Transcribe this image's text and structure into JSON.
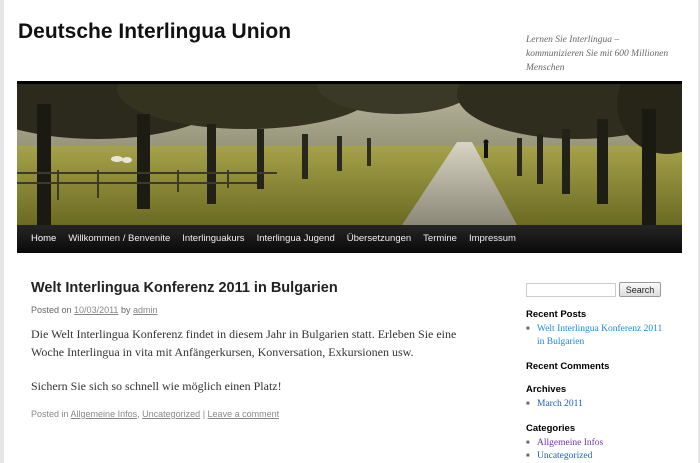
{
  "header": {
    "site_title": "Deutsche Interlingua Union",
    "site_description": "Lernen Sie Interlingua – kommunizieren Sie mit 600 Millionen Menschen"
  },
  "nav": {
    "items": [
      {
        "label": "Home"
      },
      {
        "label": "Willkommen / Benvenite"
      },
      {
        "label": "Interlinguakurs"
      },
      {
        "label": "Interlingua Jugend"
      },
      {
        "label": "Übersetzungen"
      },
      {
        "label": "Termine"
      },
      {
        "label": "Impressum"
      }
    ]
  },
  "post": {
    "title": "Welt Interlingua Konferenz 2011 in Bulgarien",
    "posted_on_prefix": "Posted on",
    "date": "10/03/2011",
    "by": "by",
    "author": "admin",
    "paragraph1": "Die Welt Interlingua Konferenz findet in diesem Jahr in Bulgarien statt. Erleben Sie eine Woche Interlingua in vita mit Anfängerkursen, Konversation, Exkursionen usw.",
    "paragraph2": "Sichern Sie sich so schnell wie möglich einen Platz!",
    "posted_in_prefix": "Posted in",
    "category1": "Allgemeine Infos",
    "comma": ",",
    "category2": "Uncategorized",
    "separator": "|",
    "comment_link": "Leave a comment"
  },
  "sidebar": {
    "search_value": "",
    "search_button": "Search",
    "recent_posts_title": "Recent Posts",
    "recent_posts": [
      "Welt Interlingua Konferenz 2011 in Bulgarien"
    ],
    "recent_comments_title": "Recent Comments",
    "archives_title": "Archives",
    "archives": [
      "March 2011"
    ],
    "categories_title": "Categories",
    "categories": [
      "Allgemeine Infos",
      "Uncategorized"
    ]
  },
  "colors": {
    "link_blue": "#1b8be0",
    "visited_purple": "#6b37a5",
    "nav_background": "#111111"
  }
}
